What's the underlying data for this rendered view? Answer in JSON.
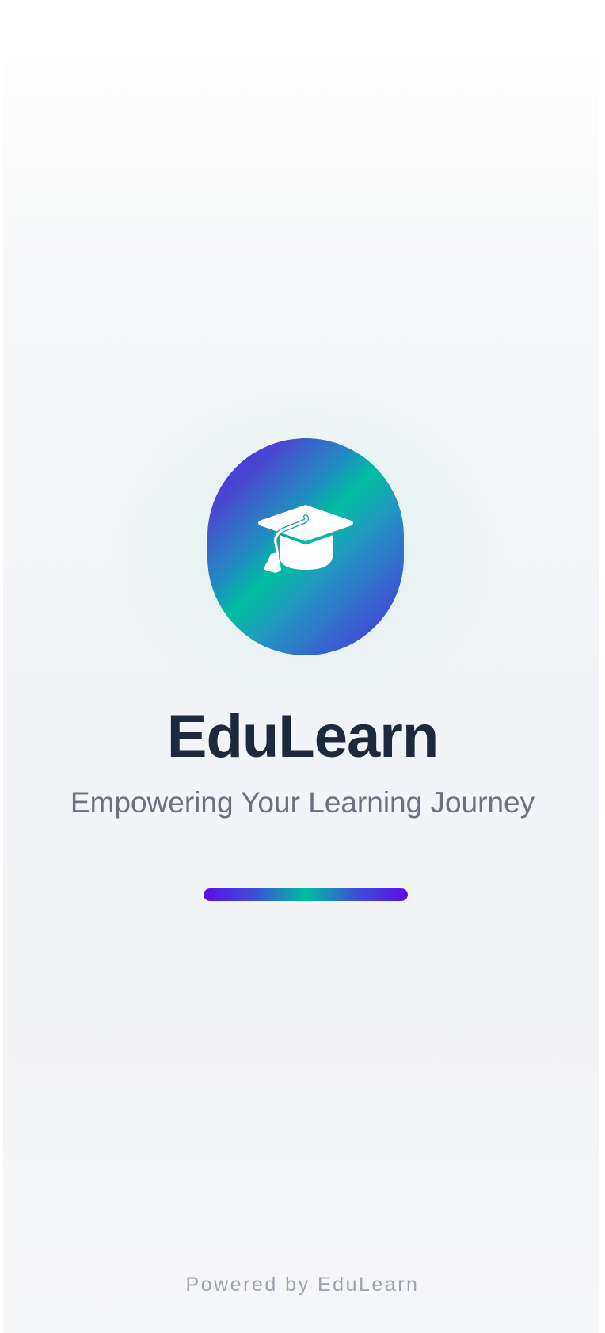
{
  "app": {
    "title": "EduLearn",
    "tagline": "Empowering Your Learning Journey"
  },
  "logo": {
    "icon": "graduation-cap-icon"
  },
  "loading": {
    "progress": 1.0
  },
  "footer": {
    "text": "Powered by EduLearn"
  },
  "colors": {
    "brand_purple": "#4b2fd6",
    "brand_teal": "#00bea0",
    "title": "#1e293b",
    "tagline": "#6b7280",
    "footer": "#9ca3af"
  }
}
